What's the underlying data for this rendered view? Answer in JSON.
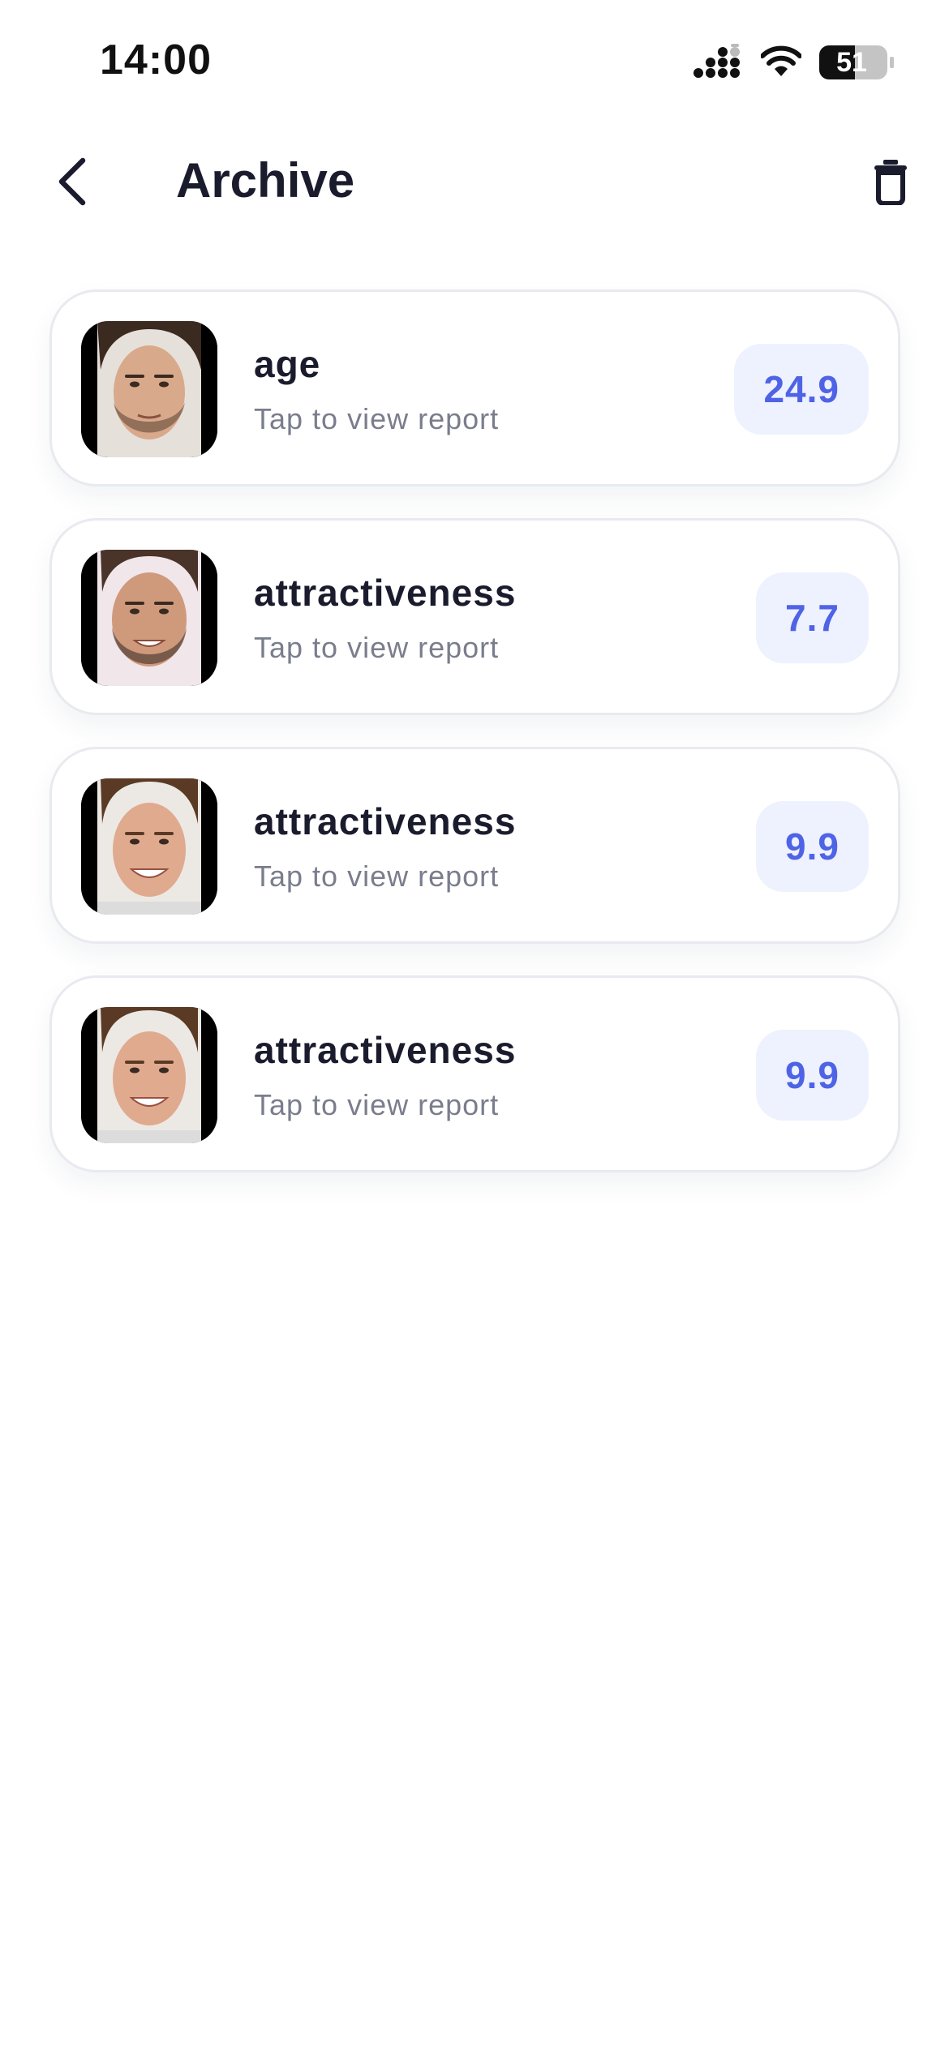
{
  "status_bar": {
    "time": "14:00",
    "battery": "51",
    "icons": [
      "cellular-signal-icon",
      "wifi-icon",
      "battery-icon"
    ]
  },
  "nav": {
    "title": "Archive",
    "back_icon": "chevron-left-icon",
    "delete_icon": "trash-icon"
  },
  "colors": {
    "title_text": "#1a1c2e",
    "subtitle_text": "#7a7d8c",
    "accent": "#4e63e6",
    "badge_bg": "#eef1fe",
    "card_border": "#e9eaf0"
  },
  "reports": [
    {
      "title": "age",
      "subtitle": "Tap to view report",
      "score": "24.9"
    },
    {
      "title": "attractiveness",
      "subtitle": "Tap to view report",
      "score": "7.7"
    },
    {
      "title": "attractiveness",
      "subtitle": "Tap to view report",
      "score": "9.9"
    },
    {
      "title": "attractiveness",
      "subtitle": "Tap to view report",
      "score": "9.9"
    }
  ]
}
